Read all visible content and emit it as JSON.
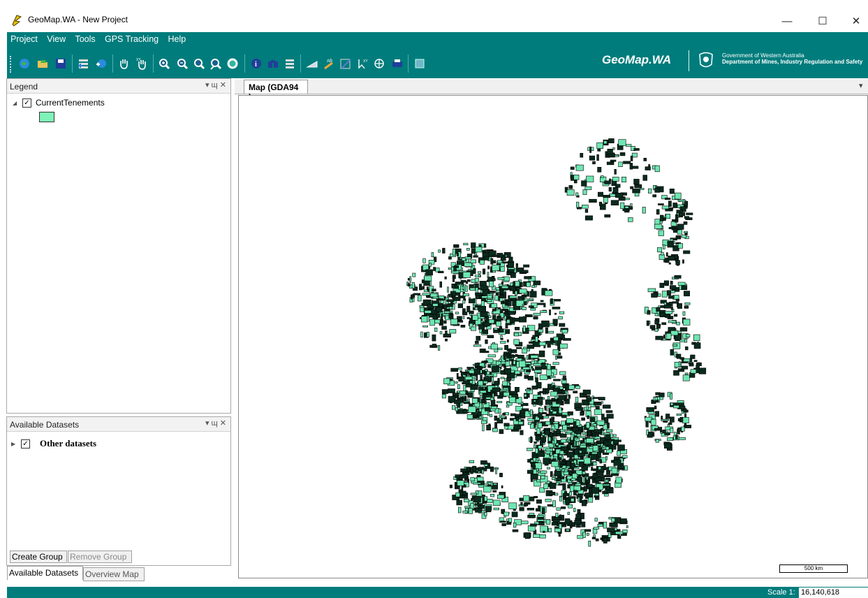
{
  "window": {
    "title": "GeoMap.WA - New Project",
    "minimize": "—",
    "maximize": "☐",
    "close": "✕"
  },
  "menu": [
    "Project",
    "View",
    "Tools",
    "GPS Tracking",
    "Help"
  ],
  "toolbar": {
    "icons": [
      "open-map-icon",
      "open-folder-icon",
      "save-icon",
      "add-layer-icon",
      "add-data-icon",
      "pan-icon",
      "pan-xy-icon",
      "zoom-in-icon",
      "zoom-out-icon",
      "zoom-previous-icon",
      "zoom-extent-icon",
      "refresh-icon",
      "identify-icon",
      "find-icon",
      "select-features-icon",
      "measure-icon",
      "annotate-icon",
      "draw-icon",
      "goto-xy-icon",
      "grid-icon",
      "print-icon",
      "export-icon"
    ],
    "brand": "GeoMap.WA",
    "gov_line1": "Government of Western Australia",
    "gov_line2": "Department of Mines, Industry Regulation and Safety"
  },
  "legend": {
    "title": "Legend",
    "pin": "▾  ɰ  ✕",
    "layer_name": "CurrentTenements",
    "layer_checked": "✓",
    "swatch_color": "#7ff3b8"
  },
  "datasets": {
    "title": "Available Datasets",
    "pin": "▾  ɰ  ✕",
    "item": "Other datasets",
    "item_checked": "✓",
    "create_group": "Create Group",
    "remove_group": "Remove Group"
  },
  "bottom_tabs": [
    "Available Datasets",
    "Overview Map"
  ],
  "map": {
    "tab": "Map (GDA94 )",
    "tab_menu": "▾",
    "scalebar_label": "500 km",
    "fill_color": "#6ee6b2",
    "outline_color": "#000000"
  },
  "status": {
    "scale_label": "Scale 1:",
    "scale_value": "16,140,618"
  }
}
